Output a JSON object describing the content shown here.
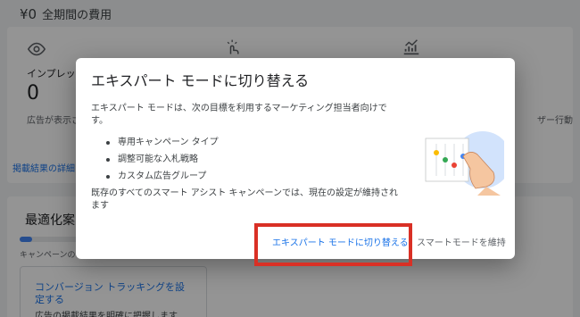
{
  "background": {
    "header": {
      "amount": "¥0",
      "label": "全期間の費用"
    },
    "stats": [
      {
        "label": "インプレッシ",
        "value": "0",
        "sub": "広告が表示さ"
      }
    ],
    "right_sub": "ザー行動",
    "link_results": "掲載結果の詳細",
    "recommendations": {
      "title": "最適化案",
      "progress_label": "キャンペーンの",
      "progress_fraction": 0.08,
      "task_title": "コンバージョン トラッキングを設定する",
      "task_sub": "広告の掲載結果を明確に把握します"
    }
  },
  "dialog": {
    "title": "エキスパート モードに切り替える",
    "intro": "エキスパート モードは、次の目標を利用するマーケティング担当者向けです。",
    "features": [
      "専用キャンペーン タイプ",
      "調整可能な入札戦略",
      "カスタム広告グループ"
    ],
    "note": "既存のすべてのスマート アシスト キャンペーンでは、現在の設定が維持されます",
    "buttons": {
      "switch_label": "エキスパート モードに切り替える",
      "keep_label": "スマートモードを維持"
    }
  },
  "colors": {
    "link": "#1a73e8",
    "highlight": "#d93025",
    "scrim": "rgba(0,0,0,0.42)"
  }
}
